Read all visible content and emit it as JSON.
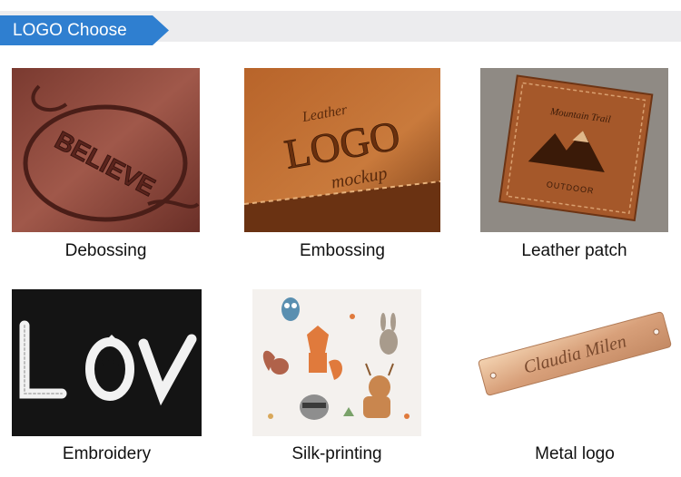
{
  "header": {
    "title": "LOGO Choose"
  },
  "colors": {
    "accent": "#2f7fd0",
    "band": "#ececee"
  },
  "tiles": [
    {
      "caption": "Debossing",
      "art_text": "BELIEVE"
    },
    {
      "caption": "Embossing",
      "art_text": [
        "Leather",
        "LOGO",
        "mockup"
      ]
    },
    {
      "caption": "Leather patch",
      "art_text": [
        "Mountain Trail",
        "OUTDOOR"
      ]
    },
    {
      "caption": "Embroidery",
      "art_text": "LOVE"
    },
    {
      "caption": "Silk-printing"
    },
    {
      "caption": "Metal logo",
      "art_text": "Claudia Milen"
    }
  ]
}
